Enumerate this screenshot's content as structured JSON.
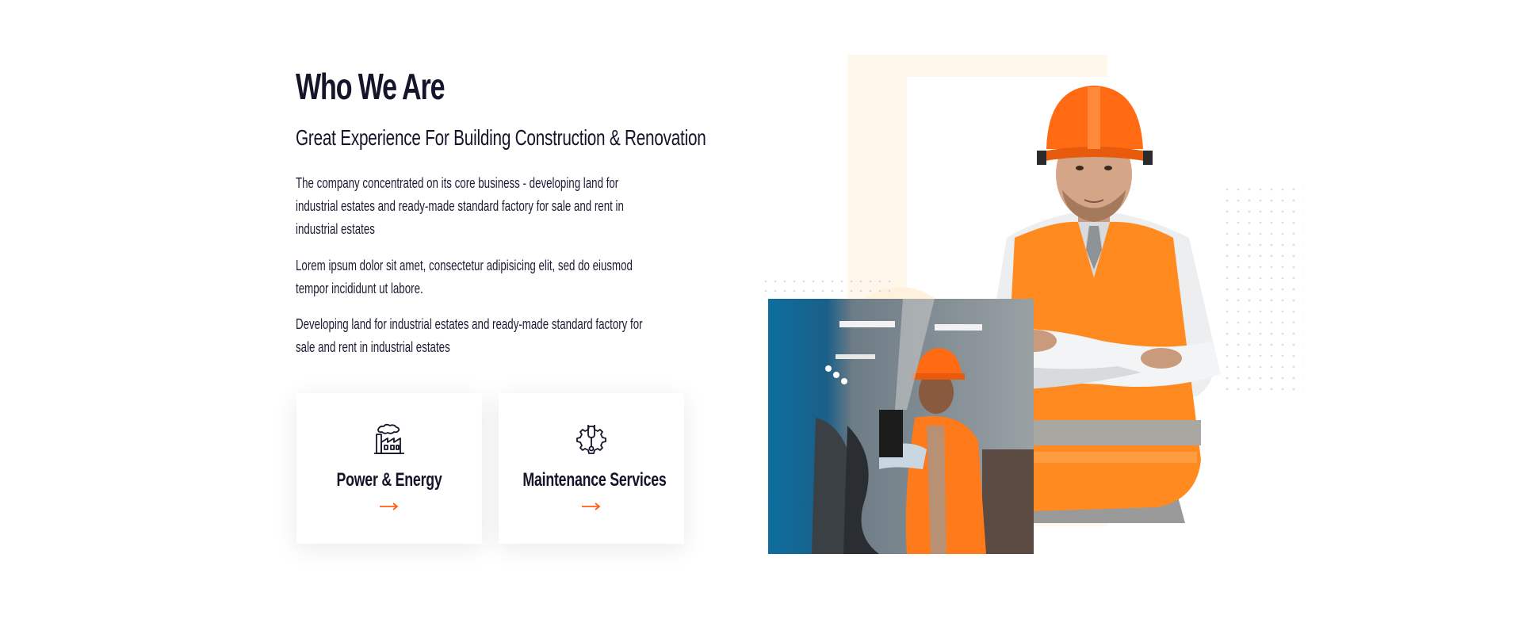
{
  "section": {
    "title": "Who We Are",
    "subtitle": "Great Experience For Building Construction & Renovation",
    "paragraphs": [
      "The company concentrated on its core business - developing land for industrial estates and ready-made standard factory for sale and rent in industrial estates",
      "Lorem ipsum dolor sit amet, consectetur adipisicing elit, sed do eiusmod tempor incididunt ut labore.",
      "Developing land for industrial estates and ready-made standard factory for sale and rent in industrial estates"
    ]
  },
  "services": [
    {
      "icon": "factory-icon",
      "title": "Power & Energy",
      "arrow": "arrow-right-icon"
    },
    {
      "icon": "gear-wrench-icon",
      "title": "Maintenance Services",
      "arrow": "arrow-right-icon"
    }
  ],
  "colors": {
    "heading": "#14142b",
    "accent": "#ff5e14",
    "safety_orange": "#ff8a1f",
    "frame_tint": "#fff6ec",
    "photo_blue": "#0e6e9e"
  },
  "images": {
    "worker_photo": "factory-worker-photo",
    "hero_person": "construction-worker-portrait"
  }
}
